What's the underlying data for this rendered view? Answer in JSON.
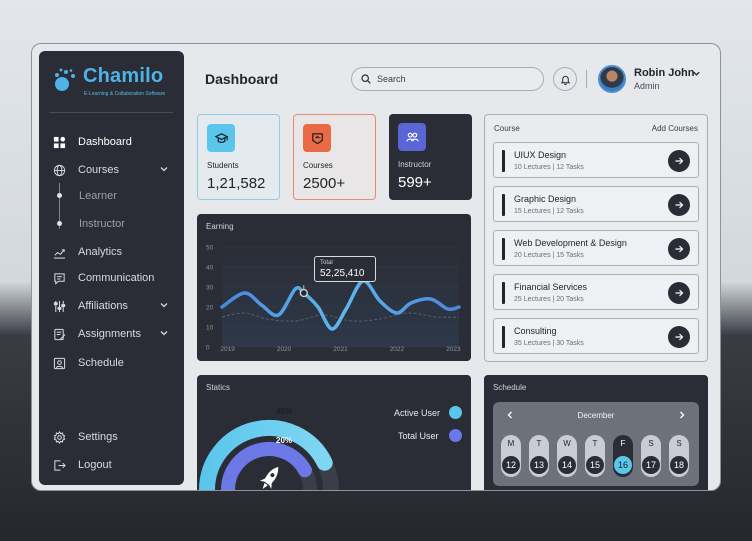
{
  "brand": {
    "name": "Chamilo",
    "tagline": "E-Learning & Collaboration Software"
  },
  "sidebar": {
    "items": [
      {
        "label": "Dashboard",
        "icon": "grid-icon"
      },
      {
        "label": "Courses",
        "icon": "globe-icon"
      },
      {
        "label": "Analytics",
        "icon": "analytics-icon"
      },
      {
        "label": "Communication",
        "icon": "chat-icon"
      },
      {
        "label": "Affiliations",
        "icon": "affiliations-icon"
      },
      {
        "label": "Assignments",
        "icon": "assignments-icon"
      },
      {
        "label": "Schedule",
        "icon": "schedule-icon"
      }
    ],
    "subitems": [
      "Learner",
      "Instructor"
    ],
    "bottom": [
      {
        "label": "Settings",
        "icon": "gear-icon"
      },
      {
        "label": "Logout",
        "icon": "logout-icon"
      }
    ]
  },
  "header": {
    "title": "Dashboard",
    "search_placeholder": "Search",
    "user_name": "Robin John",
    "user_role": "Admin"
  },
  "stats": [
    {
      "label": "Students",
      "value": "1,21,582",
      "icon": "students-icon"
    },
    {
      "label": "Courses",
      "value": "2500+",
      "icon": "courses-icon"
    },
    {
      "label": "Instructor",
      "value": "599+",
      "icon": "instructor-icon"
    }
  ],
  "earning": {
    "title": "Earning",
    "tooltip_label": "Total",
    "tooltip_value": "52,25,410"
  },
  "chart_data": {
    "type": "line",
    "title": "Earning",
    "x": [
      2019,
      2020,
      2021,
      2022,
      2023
    ],
    "ylim": [
      0,
      50
    ],
    "yticks": [
      0,
      10,
      20,
      30,
      40,
      50
    ],
    "series": [
      {
        "points": [
          [
            2018.9,
            20
          ],
          [
            2019.3,
            27
          ],
          [
            2019.6,
            21
          ],
          [
            2019.9,
            16
          ],
          [
            2020.2,
            29
          ],
          [
            2020.35,
            27
          ],
          [
            2020.6,
            20
          ],
          [
            2020.85,
            9
          ],
          [
            2021.1,
            19
          ],
          [
            2021.4,
            33
          ],
          [
            2021.7,
            23
          ],
          [
            2022.0,
            17
          ],
          [
            2022.25,
            22
          ],
          [
            2022.6,
            24
          ],
          [
            2022.9,
            19
          ],
          [
            2023.1,
            20
          ]
        ]
      },
      {
        "points": [
          [
            2018.9,
            15
          ],
          [
            2019.3,
            17
          ],
          [
            2019.7,
            14
          ],
          [
            2020.2,
            13
          ],
          [
            2020.7,
            16
          ],
          [
            2021.2,
            13
          ],
          [
            2021.7,
            14
          ],
          [
            2022.2,
            17
          ],
          [
            2022.7,
            15
          ],
          [
            2023.1,
            15
          ]
        ]
      }
    ],
    "grid": true
  },
  "colors": {
    "sidebar": "#2a2d35",
    "accent_blue": "#4fb2e8",
    "accent_cyan": "#5bc6ec",
    "accent_violet": "#6b78e6",
    "students_card": "#5bc6ec",
    "courses_card": "#e96a45",
    "instructor_card": "#5a66d6"
  },
  "courses": {
    "title": "Course",
    "add_label": "Add Courses",
    "items": [
      {
        "name": "UIUX Design",
        "meta": "10 Lectures | 12 Tasks"
      },
      {
        "name": "Graphic Design",
        "meta": "15 Lectures | 12 Tasks"
      },
      {
        "name": "Web Development & Design",
        "meta": "20 Lectures | 15 Tasks"
      },
      {
        "name": "Financial Services",
        "meta": "25 Lectures | 20 Tasks"
      },
      {
        "name": "Consulting",
        "meta": "35 Lectures | 30 Tasks"
      }
    ]
  },
  "statics": {
    "title": "Statics",
    "active_user": {
      "label": "Active User",
      "percent": "45%",
      "fraction": 0.45
    },
    "total_user": {
      "label": "Total User",
      "percent": "20%",
      "fraction": 0.2
    }
  },
  "schedule": {
    "title": "Schedule",
    "month": "December",
    "days": [
      {
        "letter": "M",
        "num": "12"
      },
      {
        "letter": "T",
        "num": "13"
      },
      {
        "letter": "W",
        "num": "14"
      },
      {
        "letter": "T",
        "num": "15"
      },
      {
        "letter": "F",
        "num": "16",
        "selected": true
      },
      {
        "letter": "S",
        "num": "17"
      },
      {
        "letter": "S",
        "num": "18"
      }
    ]
  }
}
